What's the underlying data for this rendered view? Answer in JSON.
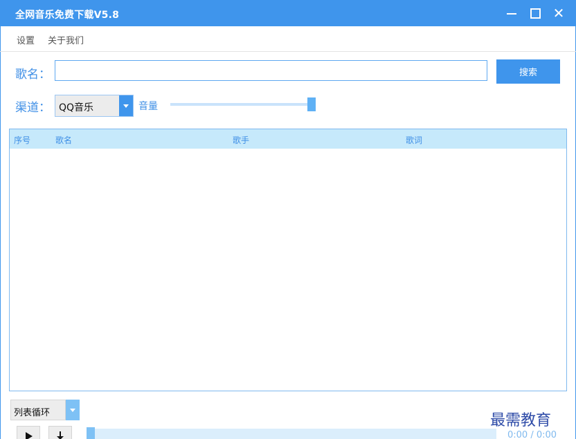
{
  "window": {
    "title": "全网音乐免费下载V5.8",
    "controls": {
      "minimize": "minimize",
      "maximize": "maximize",
      "close": "✕"
    }
  },
  "menu": {
    "items": [
      "设置",
      "关于我们"
    ]
  },
  "search": {
    "label": "歌名：",
    "value": "",
    "placeholder": "",
    "button_label": "搜索"
  },
  "channel": {
    "label": "渠道：",
    "selected": "QQ音乐"
  },
  "volume": {
    "label": "音量",
    "level": 1.0
  },
  "table": {
    "columns": [
      "序号",
      "歌名",
      "歌手",
      "歌词"
    ],
    "rows": []
  },
  "player": {
    "mode_selected": "列表循环",
    "time": "0:00 / 0:00",
    "progress": 0
  },
  "watermark": "最需教育",
  "colors": {
    "accent": "#3f95ec",
    "header_bg": "#c6e9fb",
    "label": "#3f8fe6"
  },
  "icons": [
    "minimize-icon",
    "maximize-icon",
    "close-icon",
    "chevron-down-icon",
    "play-icon",
    "download-icon"
  ]
}
